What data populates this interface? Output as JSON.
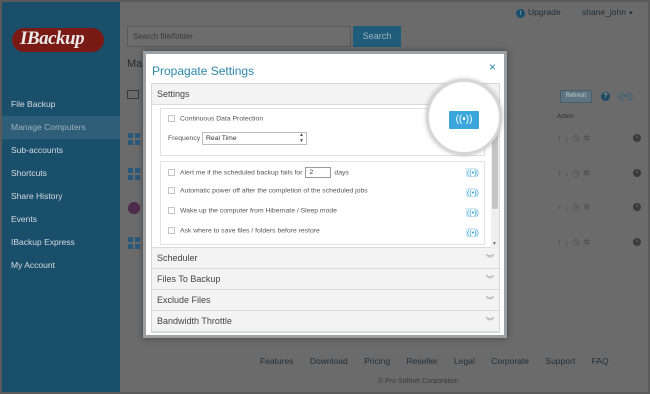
{
  "app": {
    "logo_text": "IBackup",
    "sidebar": [
      {
        "label": "File Backup",
        "active": false
      },
      {
        "label": "Manage Computers",
        "active": true
      },
      {
        "label": "Sub-accounts",
        "active": false
      },
      {
        "label": "Shortcuts",
        "active": false
      },
      {
        "label": "Share History",
        "active": false
      },
      {
        "label": "Events",
        "active": false
      },
      {
        "label": "IBackup Express",
        "active": false
      },
      {
        "label": "My Account",
        "active": false
      }
    ],
    "topbar": {
      "upgrade": "Upgrade",
      "username": "shane_john"
    },
    "search": {
      "placeholder": "Search file/folder",
      "button": "Search"
    },
    "page_heading": "Ma",
    "refresh_button": "Refresh",
    "help_icon": "?",
    "action_header": "Action",
    "footer_links": [
      "Features",
      "Download",
      "Pricing",
      "Reseller",
      "Legal",
      "Corporate",
      "Support",
      "FAQ"
    ],
    "copyright": "© Pro Softnet Corporation"
  },
  "modal": {
    "title": "Propagate Settings",
    "close": "×",
    "sections": {
      "settings": "Settings",
      "scheduler": "Scheduler",
      "files_to_backup": "Files To Backup",
      "exclude_files": "Exclude Files",
      "bandwidth_throttle": "Bandwidth Throttle"
    },
    "cdp_label": "Continuous Data Protection",
    "frequency_label": "Frequency",
    "frequency_value": "Real Time",
    "alert_prefix": "Alert me if the scheduled backup fails for",
    "alert_days_value": "2",
    "alert_suffix": "days",
    "options": [
      "Automatic power off after the completion of the scheduled jobs",
      "Wake up the computer from Hibernate / Sleep mode",
      "Ask where to save files / folders before restore"
    ]
  },
  "icons": {
    "propagate": "signal-broadcast-icon",
    "close": "close-icon",
    "chevron": "chevron-down-icon"
  },
  "colors": {
    "accent": "#2c87ad",
    "propagate_button": "#3aa6dc",
    "sidebar": "#1a4f6b"
  }
}
